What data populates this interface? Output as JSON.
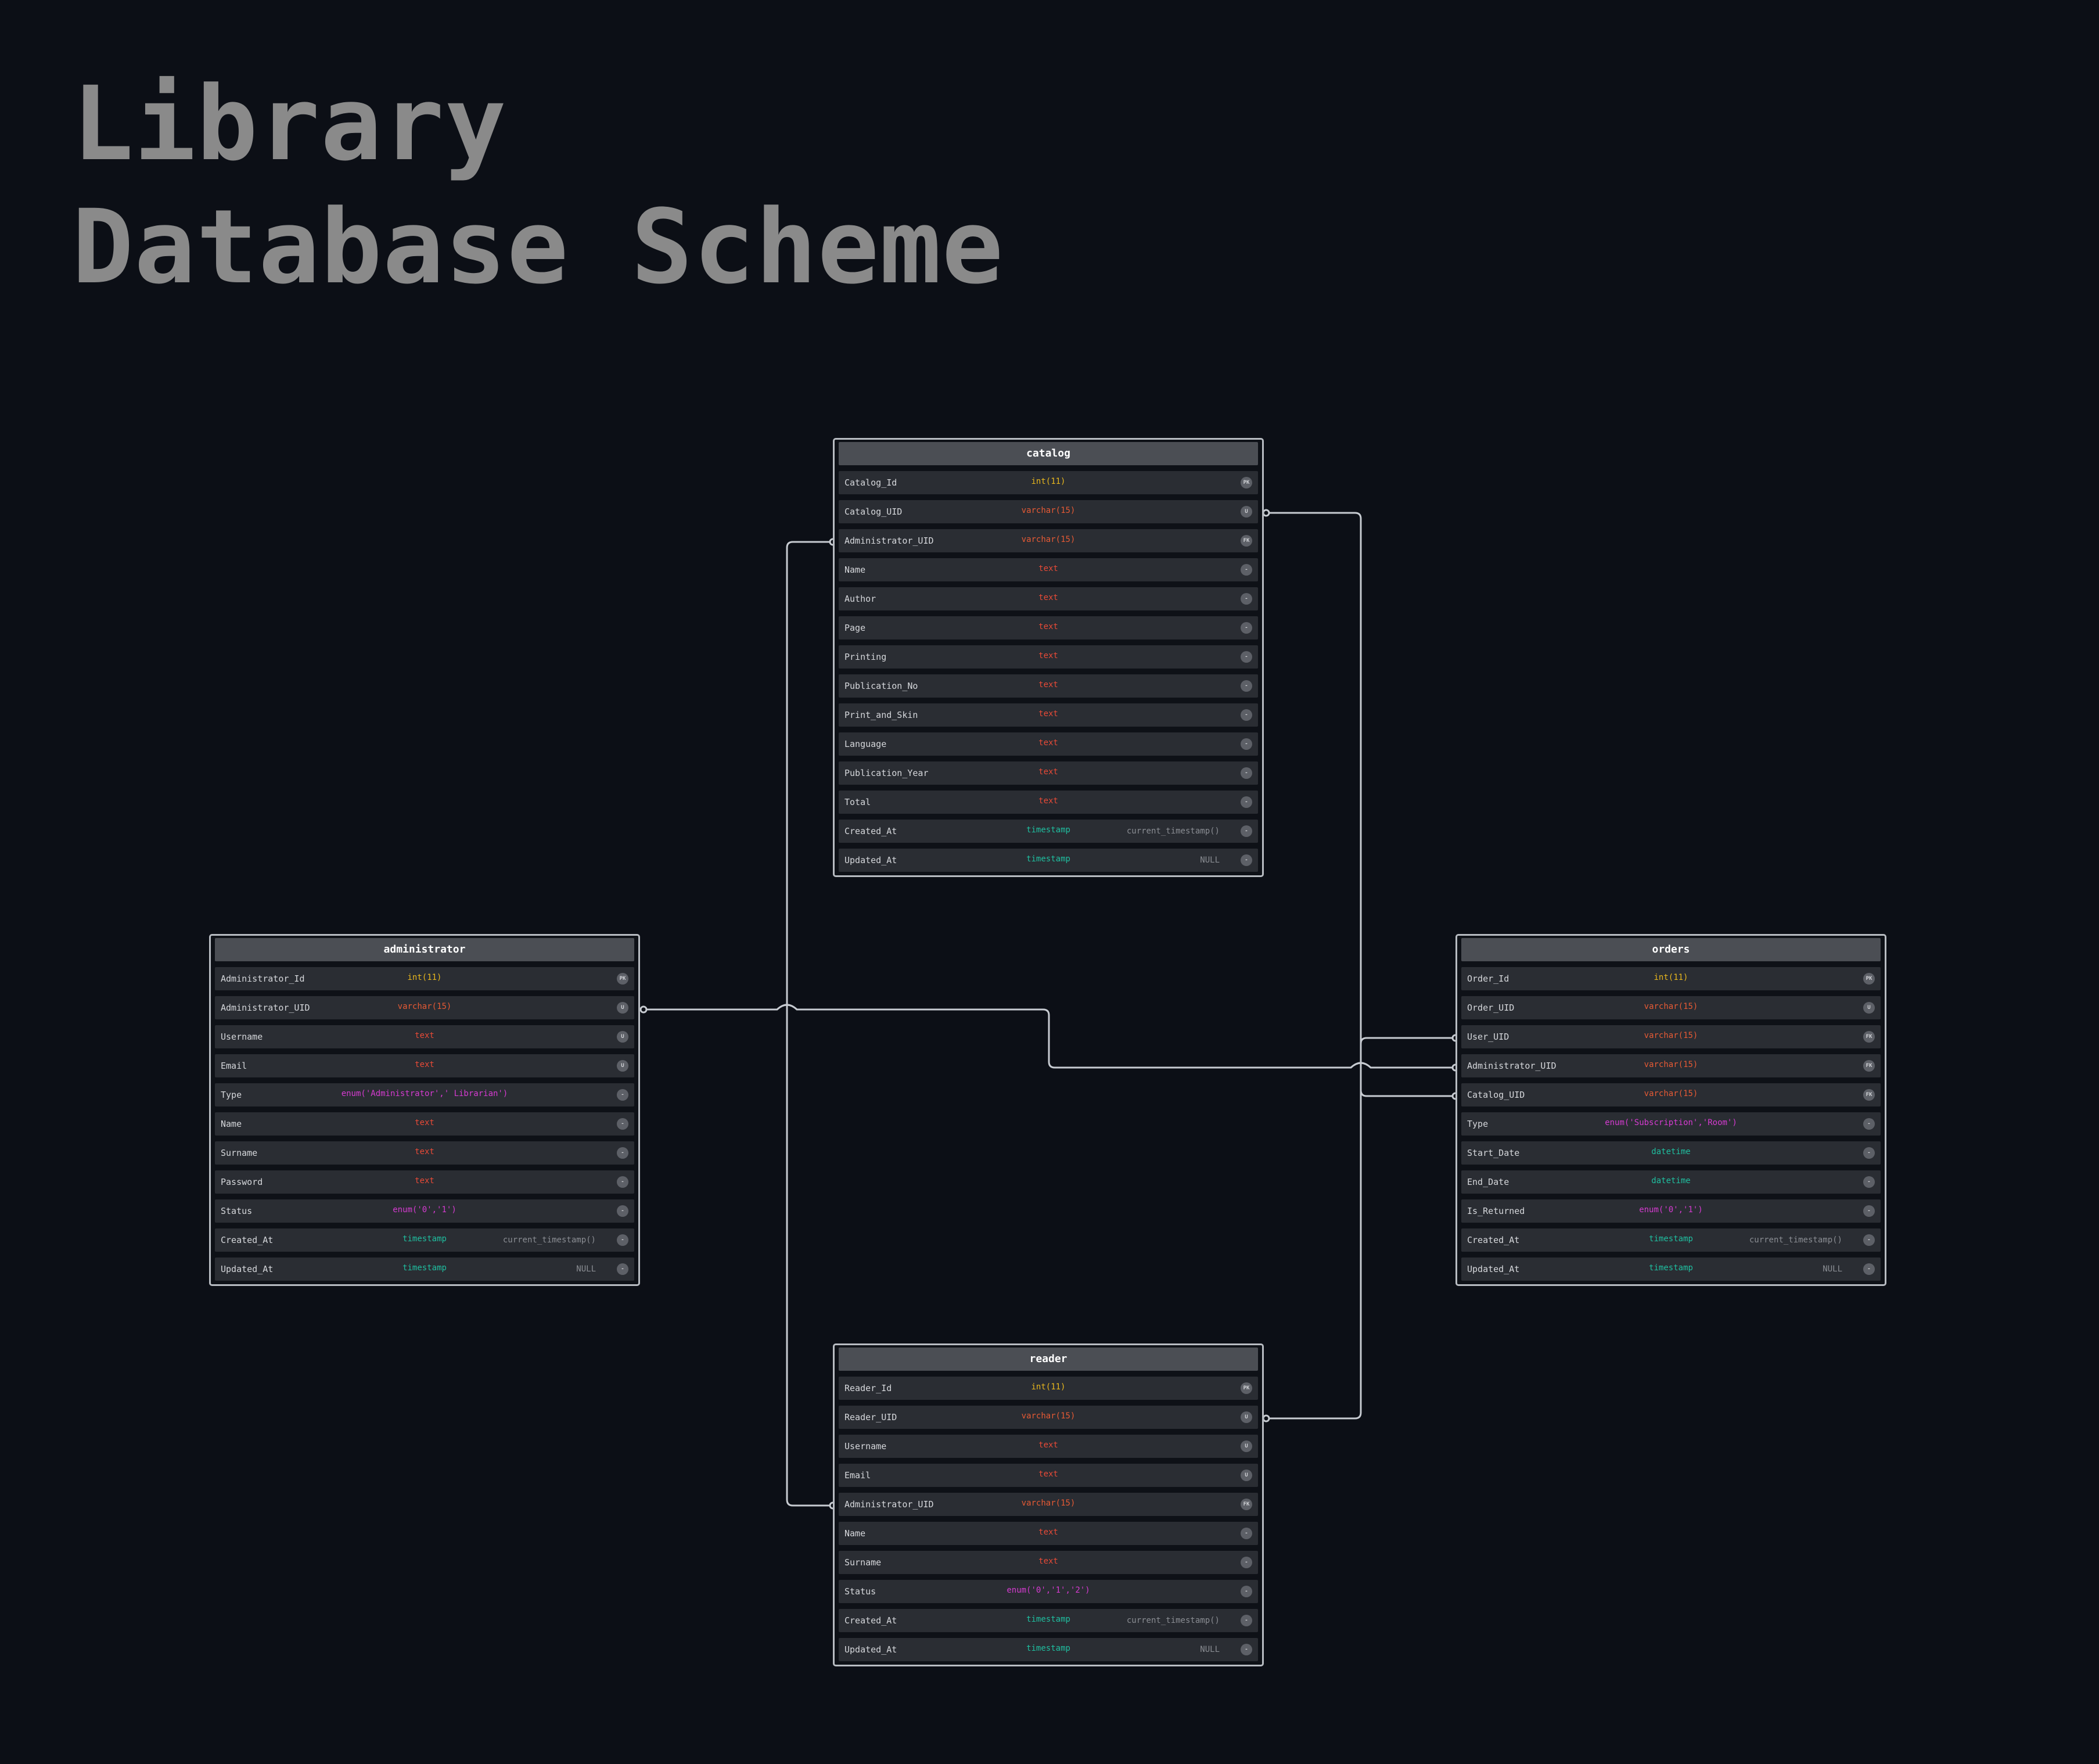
{
  "title": {
    "line1": "Library",
    "line2": "Database Scheme"
  },
  "colors": {
    "background": "#0c0f16",
    "border": "#b8bcc2",
    "int": "#e8b71d",
    "varchar": "#e65a34",
    "text": "#e84a37",
    "enum": "#d63bd1",
    "timestamp": "#1fbfa0",
    "connector": "#c7cbd1"
  },
  "tables": {
    "catalog": {
      "name": "catalog",
      "columns": [
        {
          "name": "Catalog_Id",
          "type": "int(11)",
          "badge": "PK"
        },
        {
          "name": "Catalog_UID",
          "type": "varchar(15)",
          "badge": "U"
        },
        {
          "name": "Administrator_UID",
          "type": "varchar(15)",
          "badge": "FK"
        },
        {
          "name": "Name",
          "type": "text",
          "badge": "-"
        },
        {
          "name": "Author",
          "type": "text",
          "badge": "-"
        },
        {
          "name": "Page",
          "type": "text",
          "badge": "-"
        },
        {
          "name": "Printing",
          "type": "text",
          "badge": "-"
        },
        {
          "name": "Publication_No",
          "type": "text",
          "badge": "-"
        },
        {
          "name": "Print_and_Skin",
          "type": "text",
          "badge": "-"
        },
        {
          "name": "Language",
          "type": "text",
          "badge": "-"
        },
        {
          "name": "Publication_Year",
          "type": "text",
          "badge": "-"
        },
        {
          "name": "Total",
          "type": "text",
          "badge": "-"
        },
        {
          "name": "Created_At",
          "type": "timestamp",
          "default": "current_timestamp()",
          "badge": "-"
        },
        {
          "name": "Updated_At",
          "type": "timestamp",
          "default": "NULL",
          "badge": "-"
        }
      ]
    },
    "administrator": {
      "name": "administrator",
      "columns": [
        {
          "name": "Administrator_Id",
          "type": "int(11)",
          "badge": "PK"
        },
        {
          "name": "Administrator_UID",
          "type": "varchar(15)",
          "badge": "U"
        },
        {
          "name": "Username",
          "type": "text",
          "badge": "U"
        },
        {
          "name": "Email",
          "type": "text",
          "badge": "U"
        },
        {
          "name": "Type",
          "type": "enum('Administrator',' Librarian')",
          "badge": "-"
        },
        {
          "name": "Name",
          "type": "text",
          "badge": "-"
        },
        {
          "name": "Surname",
          "type": "text",
          "badge": "-"
        },
        {
          "name": "Password",
          "type": "text",
          "badge": "-"
        },
        {
          "name": "Status",
          "type": "enum('0','1')",
          "badge": "-"
        },
        {
          "name": "Created_At",
          "type": "timestamp",
          "default": "current_timestamp()",
          "badge": "-"
        },
        {
          "name": "Updated_At",
          "type": "timestamp",
          "default": "NULL",
          "badge": "-"
        }
      ]
    },
    "orders": {
      "name": "orders",
      "columns": [
        {
          "name": "Order_Id",
          "type": "int(11)",
          "badge": "PK"
        },
        {
          "name": "Order_UID",
          "type": "varchar(15)",
          "badge": "U"
        },
        {
          "name": "User_UID",
          "type": "varchar(15)",
          "badge": "FK"
        },
        {
          "name": "Administrator_UID",
          "type": "varchar(15)",
          "badge": "FK"
        },
        {
          "name": "Catalog_UID",
          "type": "varchar(15)",
          "badge": "FK"
        },
        {
          "name": "Type",
          "type": "enum('Subscription','Room')",
          "badge": "-"
        },
        {
          "name": "Start_Date",
          "type": "datetime",
          "badge": "-"
        },
        {
          "name": "End_Date",
          "type": "datetime",
          "badge": "-"
        },
        {
          "name": "Is_Returned",
          "type": "enum('0','1')",
          "badge": "-"
        },
        {
          "name": "Created_At",
          "type": "timestamp",
          "default": "current_timestamp()",
          "badge": "-"
        },
        {
          "name": "Updated_At",
          "type": "timestamp",
          "default": "NULL",
          "badge": "-"
        }
      ]
    },
    "reader": {
      "name": "reader",
      "columns": [
        {
          "name": "Reader_Id",
          "type": "int(11)",
          "badge": "PK"
        },
        {
          "name": "Reader_UID",
          "type": "varchar(15)",
          "badge": "U"
        },
        {
          "name": "Username",
          "type": "text",
          "badge": "U"
        },
        {
          "name": "Email",
          "type": "text",
          "badge": "U"
        },
        {
          "name": "Administrator_UID",
          "type": "varchar(15)",
          "badge": "FK"
        },
        {
          "name": "Name",
          "type": "text",
          "badge": "-"
        },
        {
          "name": "Surname",
          "type": "text",
          "badge": "-"
        },
        {
          "name": "Status",
          "type": "enum('0','1','2')",
          "badge": "-"
        },
        {
          "name": "Created_At",
          "type": "timestamp",
          "default": "current_timestamp()",
          "badge": "-"
        },
        {
          "name": "Updated_At",
          "type": "timestamp",
          "default": "NULL",
          "badge": "-"
        }
      ]
    }
  }
}
